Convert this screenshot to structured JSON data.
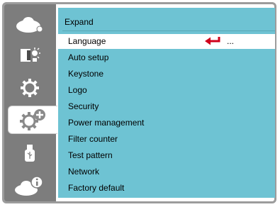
{
  "sidebar": {
    "items": [
      {
        "icon": "picture-icon",
        "active": false
      },
      {
        "icon": "image-settings-icon",
        "active": false
      },
      {
        "icon": "setup-gear-icon",
        "active": false
      },
      {
        "icon": "expand-gear-plus-icon",
        "active": true
      },
      {
        "icon": "usb-icon",
        "active": false
      },
      {
        "icon": "info-icon",
        "active": false
      }
    ]
  },
  "panel": {
    "title": "Expand",
    "items": [
      {
        "label": "Language",
        "selected": true,
        "value": "..."
      },
      {
        "label": "Auto setup"
      },
      {
        "label": "Keystone"
      },
      {
        "label": "Logo"
      },
      {
        "label": "Security"
      },
      {
        "label": "Power management"
      },
      {
        "label": "Filter counter"
      },
      {
        "label": "Test pattern"
      },
      {
        "label": "Network"
      },
      {
        "label": "Factory default"
      }
    ]
  },
  "colors": {
    "panel": "#6ec3d3",
    "sidebar": "#7d7d7d",
    "enter_arrow": "#d0021b"
  }
}
